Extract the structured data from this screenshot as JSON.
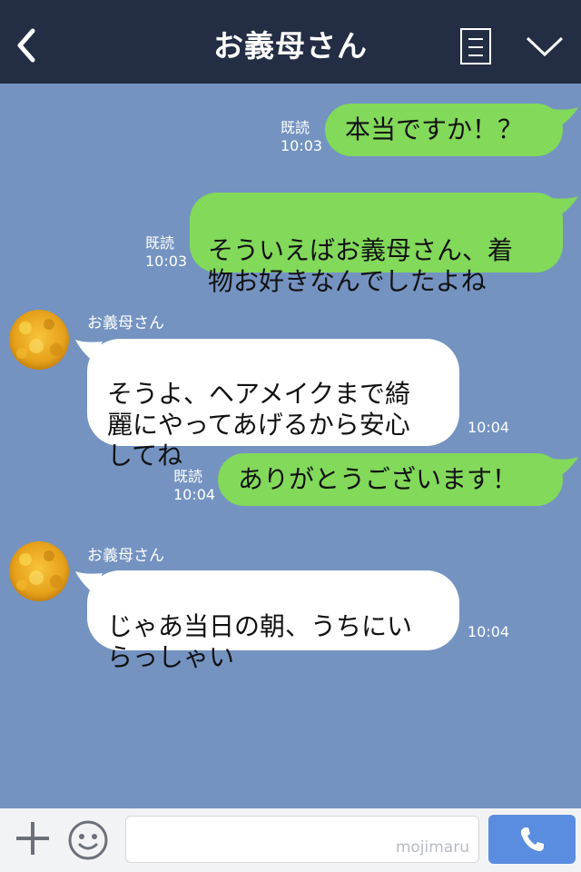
{
  "header": {
    "title": "お義母さん"
  },
  "messages": [
    {
      "type": "out",
      "text": "本当ですか！？",
      "read": "既読",
      "time": "10:03"
    },
    {
      "type": "out",
      "text": "そういえばお義母さん、着\n物お好きなんでしたよね",
      "read": "既読",
      "time": "10:03"
    },
    {
      "type": "in",
      "sender": "お義母さん",
      "text": "そうよ、ヘアメイクまで綺\n麗にやってあげるから安心\nしてね",
      "time": "10:04"
    },
    {
      "type": "out",
      "text": "ありがとうございます！",
      "read": "既読",
      "time": "10:04"
    },
    {
      "type": "in",
      "sender": "お義母さん",
      "text": "じゃあ当日の朝、うちにい\nらっしゃい",
      "time": "10:04"
    }
  ],
  "footer": {
    "watermark": "mojimaru",
    "icons": [
      "plus-icon",
      "smile-icon",
      "phone-icon"
    ]
  },
  "colors": {
    "header_bg": "#232d43",
    "chat_bg": "#7493c1",
    "outgoing": "#82d95a",
    "incoming": "#ffffff",
    "call_button": "#5a8de0"
  }
}
